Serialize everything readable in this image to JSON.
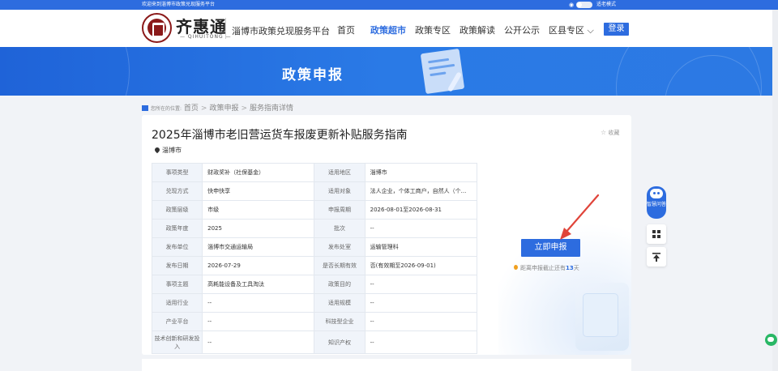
{
  "topbar": {
    "welcome": "欢迎来到淄博市政策兑现服务平台",
    "elder_mode": "适老模式"
  },
  "header": {
    "logo_text": "齐惠通",
    "logo_sub": "— QIHUITONG —",
    "platform": "淄博市政策兑现服务平台",
    "nav": [
      {
        "label": "首页"
      },
      {
        "label": "政策超市"
      },
      {
        "label": "政策专区"
      },
      {
        "label": "政策解读"
      },
      {
        "label": "公开公示"
      },
      {
        "label": "区县专区 ⌵"
      }
    ],
    "login": "登录"
  },
  "banner": {
    "title": "政策申报"
  },
  "breadcrumb": {
    "here": "您所在的位置:",
    "items": [
      "首页",
      "政策申报",
      "服务指南详情"
    ]
  },
  "policy": {
    "title": "2025年淄博市老旧营运货车报废更新补贴服务指南",
    "favorite": "收藏",
    "region": "淄博市",
    "rows": [
      [
        "事项类型",
        "财政奖补（社保基金）",
        "适用地区",
        "淄博市"
      ],
      [
        "兑现方式",
        "快申快享",
        "适用对象",
        "法人企业，个体工商户，自然人（个..."
      ],
      [
        "政策层级",
        "市级",
        "申报周期",
        "2026-08-01至2026-08-31"
      ],
      [
        "政策年度",
        "2025",
        "批次",
        "--"
      ],
      [
        "发布单位",
        "淄博市交通运输局",
        "发布处室",
        "运输管理科"
      ],
      [
        "发布日期",
        "2026-07-29",
        "是否长期有效",
        "否(有效期至2026-09-01)"
      ],
      [
        "事项主题",
        "高耗能设备及工具淘汰",
        "政策目的",
        "--"
      ],
      [
        "适用行业",
        "--",
        "适用规模",
        "--"
      ],
      [
        "产业平台",
        "--",
        "科技型企业",
        "--"
      ],
      [
        "技术创新和研发投入",
        "--",
        "知识产权",
        "--"
      ]
    ],
    "apply": "立即申报",
    "deadline_prefix": "距离申报截止还有",
    "deadline_days": "13",
    "deadline_unit": "天"
  },
  "side_tools": {
    "robot_label": "智慧问答"
  },
  "colors": {
    "primary": "#2d6cdf",
    "label_bg": "#f0f4fa",
    "arrow": "#e0443a"
  }
}
